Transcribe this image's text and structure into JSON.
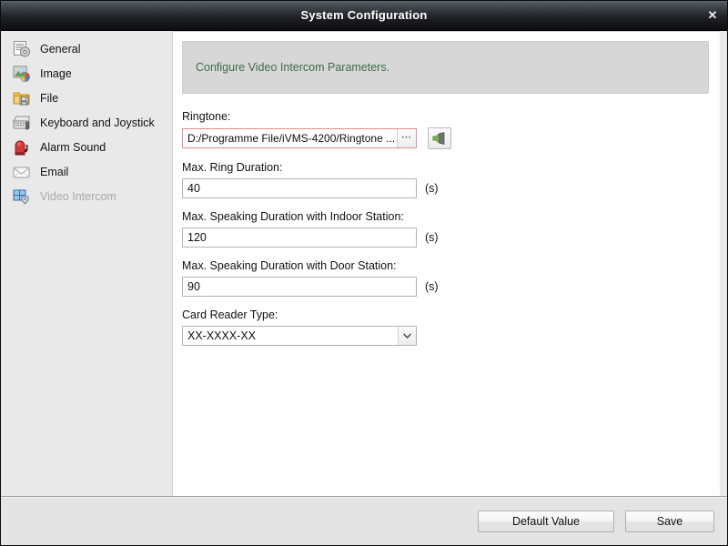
{
  "window": {
    "title": "System Configuration",
    "close_label": "✕"
  },
  "sidebar": {
    "items": [
      {
        "label": "General",
        "icon": "document-gear-icon",
        "disabled": false
      },
      {
        "label": "Image",
        "icon": "picture-icon",
        "disabled": false
      },
      {
        "label": "File",
        "icon": "folder-save-icon",
        "disabled": false
      },
      {
        "label": "Keyboard and Joystick",
        "icon": "keyboard-icon",
        "disabled": false
      },
      {
        "label": "Alarm Sound",
        "icon": "alarm-siren-icon",
        "disabled": false
      },
      {
        "label": "Email",
        "icon": "envelope-icon",
        "disabled": false
      },
      {
        "label": "Video Intercom",
        "icon": "video-grid-icon",
        "disabled": true
      }
    ]
  },
  "content": {
    "banner_text": "Configure Video Intercom Parameters.",
    "banner_text_color": "#3f6b47",
    "ringtone": {
      "label": "Ringtone:",
      "value": "D:/Programme File/iVMS-4200/Ringtone ...",
      "placeholder": "",
      "browse_label": "⋯",
      "invalid_border_color": "#e08d8d",
      "play_icon": "speaker-play-icon"
    },
    "max_ring_duration": {
      "label": "Max. Ring Duration:",
      "value": "40",
      "unit": "(s)"
    },
    "max_speaking_indoor": {
      "label": "Max. Speaking Duration with Indoor Station:",
      "value": "120",
      "unit": "(s)"
    },
    "max_speaking_door": {
      "label": "Max. Speaking Duration with Door Station:",
      "value": "90",
      "unit": "(s)"
    },
    "card_reader_type": {
      "label": "Card Reader Type:",
      "value": "XX-XXXX-XX",
      "options": [
        "XX-XXXX-XX"
      ]
    }
  },
  "footer": {
    "default_value_label": "Default Value",
    "save_label": "Save"
  }
}
